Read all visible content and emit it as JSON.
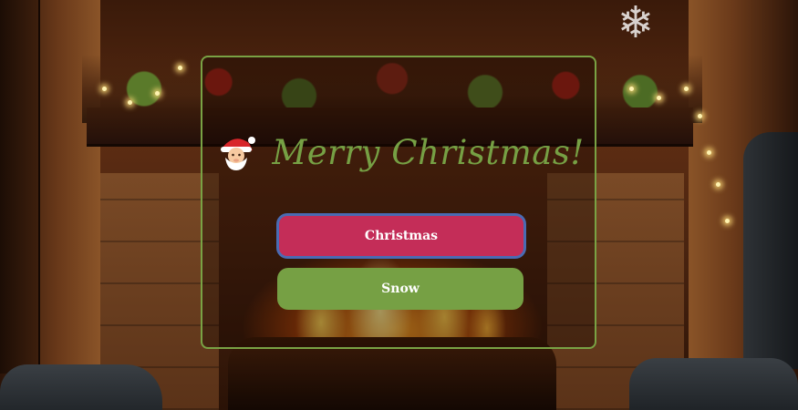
{
  "card": {
    "title": "Merry Christmas!",
    "title_icon": "santa-icon"
  },
  "buttons": {
    "christmas_label": "Christmas",
    "snow_label": "Snow"
  },
  "colors": {
    "card_border": "#79a244",
    "title": "#76a044",
    "christmas_button": "#c42d58",
    "christmas_button_border": "#4a6bb3",
    "snow_button": "#76a044"
  }
}
